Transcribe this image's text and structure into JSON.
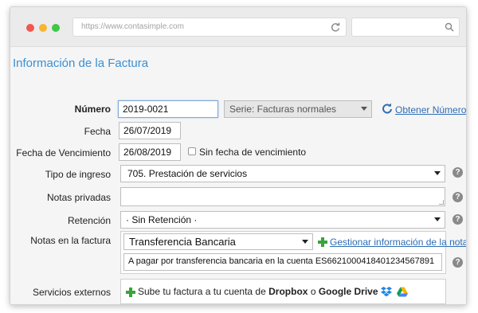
{
  "browser": {
    "url": "https://www.contasimple.com",
    "search_placeholder": ""
  },
  "page": {
    "title": "Información de la Factura"
  },
  "form": {
    "numero": {
      "label": "Número",
      "value": "2019-0021",
      "serie": "Serie: Facturas normales",
      "link": "Obtener Número"
    },
    "fecha": {
      "label": "Fecha",
      "value": "26/07/2019"
    },
    "vencimiento": {
      "label": "Fecha de Vencimiento",
      "value": "26/08/2019",
      "checkbox_label": "Sin fecha de vencimiento"
    },
    "tipo_ingreso": {
      "label": "Tipo de ingreso",
      "value": "705. Prestación de servicios"
    },
    "notas_privadas": {
      "label": "Notas privadas",
      "value": ""
    },
    "retencion": {
      "label": "Retención",
      "value": "· Sin Retención ·"
    },
    "notas_factura": {
      "label": "Notas en la factura",
      "select_value": "Transferencia Bancaria",
      "link": "Gestionar información de la nota",
      "text": "A pagar por transferencia bancaria en la cuenta ES6621000418401234567891"
    },
    "servicios": {
      "label": "Servicios externos",
      "prefix": "Sube tu factura a tu cuenta de",
      "dropbox": "Dropbox",
      "or": "o",
      "gdrive": "Google Drive"
    }
  },
  "help_glyph": "?",
  "colors": {
    "accent": "#3b8fd4",
    "link": "#2d6db5",
    "plus": "#3aa33a"
  }
}
